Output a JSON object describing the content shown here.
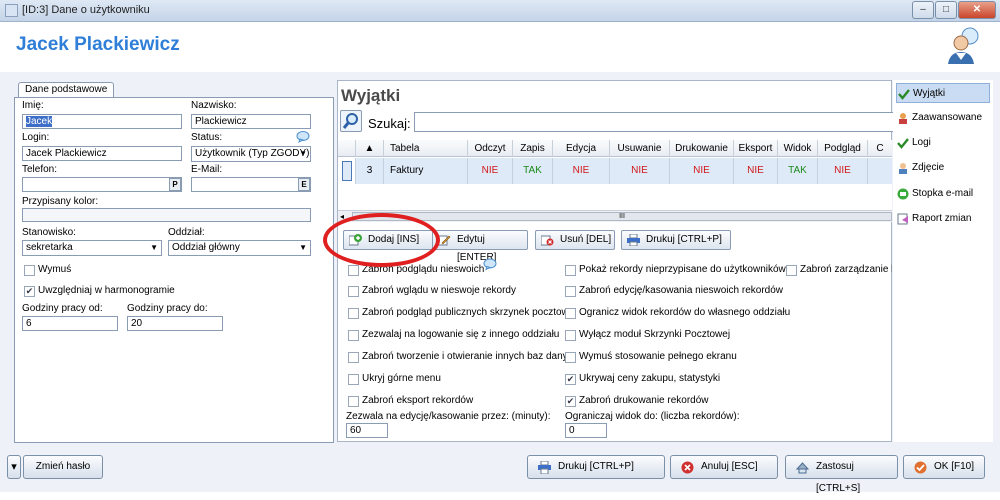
{
  "window": {
    "title": "[ID:3] Dane o użytkowniku",
    "minimize": "–",
    "maximize": "□",
    "close": "✕"
  },
  "header": {
    "name": "Jacek Plackiewicz"
  },
  "left": {
    "tab": "Dane podstawowe",
    "imie_label": "Imię:",
    "imie_value": "Jacek",
    "nazwisko_label": "Nazwisko:",
    "nazwisko_value": "Plackiewicz",
    "login_label": "Login:",
    "login_value": "Jacek Plackiewicz",
    "status_label": "Status:",
    "status_value": "Użytkownik (Typ ZGODY)",
    "telefon_label": "Telefon:",
    "telefon_btn": "P",
    "email_label": "E-Mail:",
    "email_btn": "E",
    "kolor_label": "Przypisany kolor:",
    "stanowisko_label": "Stanowisko:",
    "stanowisko_value": "sekretarka",
    "oddzial_label": "Oddział:",
    "oddzial_value": "Oddział główny",
    "wymus_label": "Wymuś",
    "harmonogram_label": "Uwzględniaj w harmonogramie",
    "godz_od_label": "Godziny pracy od:",
    "godz_od_value": "6",
    "godz_do_label": "Godziny pracy do:",
    "godz_do_value": "20"
  },
  "main": {
    "title": "Wyjątki",
    "search_label": "Szukaj:",
    "columns": [
      "Tabela",
      "Odczyt",
      "Zapis",
      "Edycja",
      "Usuwanie",
      "Drukowanie",
      "Eksport",
      "Widok",
      "Podgląd",
      "C"
    ],
    "row": {
      "id": "3",
      "cells": [
        "Faktury",
        "NIE",
        "TAK",
        "NIE",
        "NIE",
        "NIE",
        "NIE",
        "TAK",
        "NIE"
      ]
    },
    "scroll_grip": "III",
    "buttons": {
      "dodaj": "Dodaj [INS]",
      "edytuj": "Edytuj [ENTER]",
      "usun": "Usuń [DEL]",
      "drukuj": "Drukuj [CTRL+P]"
    },
    "checks": [
      {
        "label": "Zabroń podglądu nieswoich",
        "checked": false
      },
      {
        "label": "Pokaż rekordy nieprzypisane do użytkowników",
        "checked": false
      },
      {
        "label": "Zabroń zarządzanie kat",
        "checked": false
      },
      {
        "label": "Zabroń wglądu w nieswoje rekordy",
        "checked": false
      },
      {
        "label": "Zabroń edycję/kasowania nieswoich rekordów",
        "checked": false
      },
      {
        "label": "Zabroń podgląd publicznych skrzynek pocztowych",
        "checked": false
      },
      {
        "label": "Ogranicz widok rekordów do własnego oddziału",
        "checked": false
      },
      {
        "label": "Zezwalaj na logowanie się z innego oddziału",
        "checked": false
      },
      {
        "label": "Wyłącz moduł Skrzynki Pocztowej",
        "checked": false
      },
      {
        "label": "Zabroń tworzenie i otwieranie innych baz danych",
        "checked": false
      },
      {
        "label": "Wymuś stosowanie pełnego ekranu",
        "checked": false
      },
      {
        "label": "Ukryj górne menu",
        "checked": false
      },
      {
        "label": "Ukrywaj ceny zakupu, statystyki",
        "checked": true
      },
      {
        "label": "Zabroń eksport rekordów",
        "checked": false
      },
      {
        "label": "Zabroń drukowanie rekordów",
        "checked": true
      }
    ],
    "edit_minutes_label": "Zezwala na edycję/kasowanie przez: (minuty):",
    "edit_minutes_value": "60",
    "limit_label": "Ograniczaj widok do: (liczba rekordów):",
    "limit_value": "0"
  },
  "sidebar": {
    "items": [
      {
        "label": "Wyjątki",
        "icon": "check-icon"
      },
      {
        "label": "Zaawansowane",
        "icon": "user-icon"
      },
      {
        "label": "Logi",
        "icon": "check-icon"
      },
      {
        "label": "Zdjęcie",
        "icon": "photo-icon"
      },
      {
        "label": "Stopka e-mail",
        "icon": "mail-icon"
      },
      {
        "label": "Raport zmian",
        "icon": "report-icon"
      }
    ]
  },
  "footer": {
    "dropdown": "▾",
    "change_password": "Zmień hasło",
    "print": "Drukuj [CTRL+P]",
    "cancel": "Anuluj [ESC]",
    "apply": "Zastosuj [CTRL+S]",
    "ok": "OK [F10]"
  },
  "colors": {
    "accent": "#2f7ed8",
    "nie": "#d01818",
    "tak": "#1a8a1a",
    "highlight": "#e02020"
  }
}
